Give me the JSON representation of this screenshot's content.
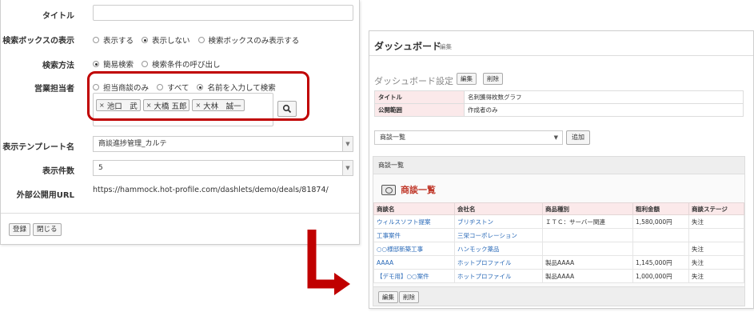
{
  "settings_form": {
    "title_label": "タイトル",
    "title_value": "",
    "search_box_label": "検索ボックスの表示",
    "search_box_options": [
      "表示する",
      "表示しない",
      "検索ボックスのみ表示する"
    ],
    "search_box_selected": 1,
    "search_method_label": "検索方法",
    "search_method_options": [
      "簡易検索",
      "検索条件の呼び出し"
    ],
    "search_method_selected": 0,
    "sales_rep_label": "営業担当者",
    "sales_rep_options": [
      "担当商談のみ",
      "すべて",
      "名前を入力して検索"
    ],
    "sales_rep_selected": 2,
    "sales_rep_tags": [
      "池口　武",
      "大橋 五郎",
      "大林　誠一"
    ],
    "template_label": "表示テンプレート名",
    "template_value": "商談進捗管理_カルテ",
    "count_label": "表示件数",
    "count_value": "5",
    "url_label": "外部公開用URL",
    "url_value": "https://hammock.hot-profile.com/dashlets/demo/deals/81874/",
    "register_button": "登録",
    "close_button": "閉じる"
  },
  "dashboard": {
    "title": "ダッシュボード",
    "title_edit": "編集",
    "setting_label": "ダッシュボード設定",
    "edit_button": "編集",
    "delete_button": "削除",
    "settings_rows": [
      {
        "key": "タイトル",
        "value": "名刺獲得枚数グラフ"
      },
      {
        "key": "公開範囲",
        "value": "作成者のみ"
      }
    ],
    "widget_select": "商談一覧",
    "add_button": "追加",
    "widget_header": "商談一覧",
    "widget_title": "商談一覧",
    "columns": [
      "商談名",
      "会社名",
      "商品種別",
      "粗利金額",
      "商談ステージ"
    ],
    "rows": [
      [
        "ウィルスソフト提案",
        "ブリヂストン",
        "ＩＴＣ：サーバー関連",
        "1,580,000円",
        "失注"
      ],
      [
        "工事案件",
        "三栄コーポレーション",
        "",
        "",
        ""
      ],
      [
        "○○様邸新築工事",
        "ハンモック薬品",
        "",
        "",
        "失注"
      ],
      [
        "AAAA",
        "ホットプロファイル",
        "製品AAAA",
        "1,145,000円",
        "失注"
      ],
      [
        "【デモ用】○○案件",
        "ホットプロファイル",
        "製品AAAA",
        "1,000,000円",
        "失注"
      ]
    ],
    "footer_edit": "編集",
    "footer_delete": "削除"
  },
  "colors": {
    "accent_red": "#c00000",
    "link_blue": "#2a6ab8",
    "header_pink": "#fbe9ea"
  }
}
